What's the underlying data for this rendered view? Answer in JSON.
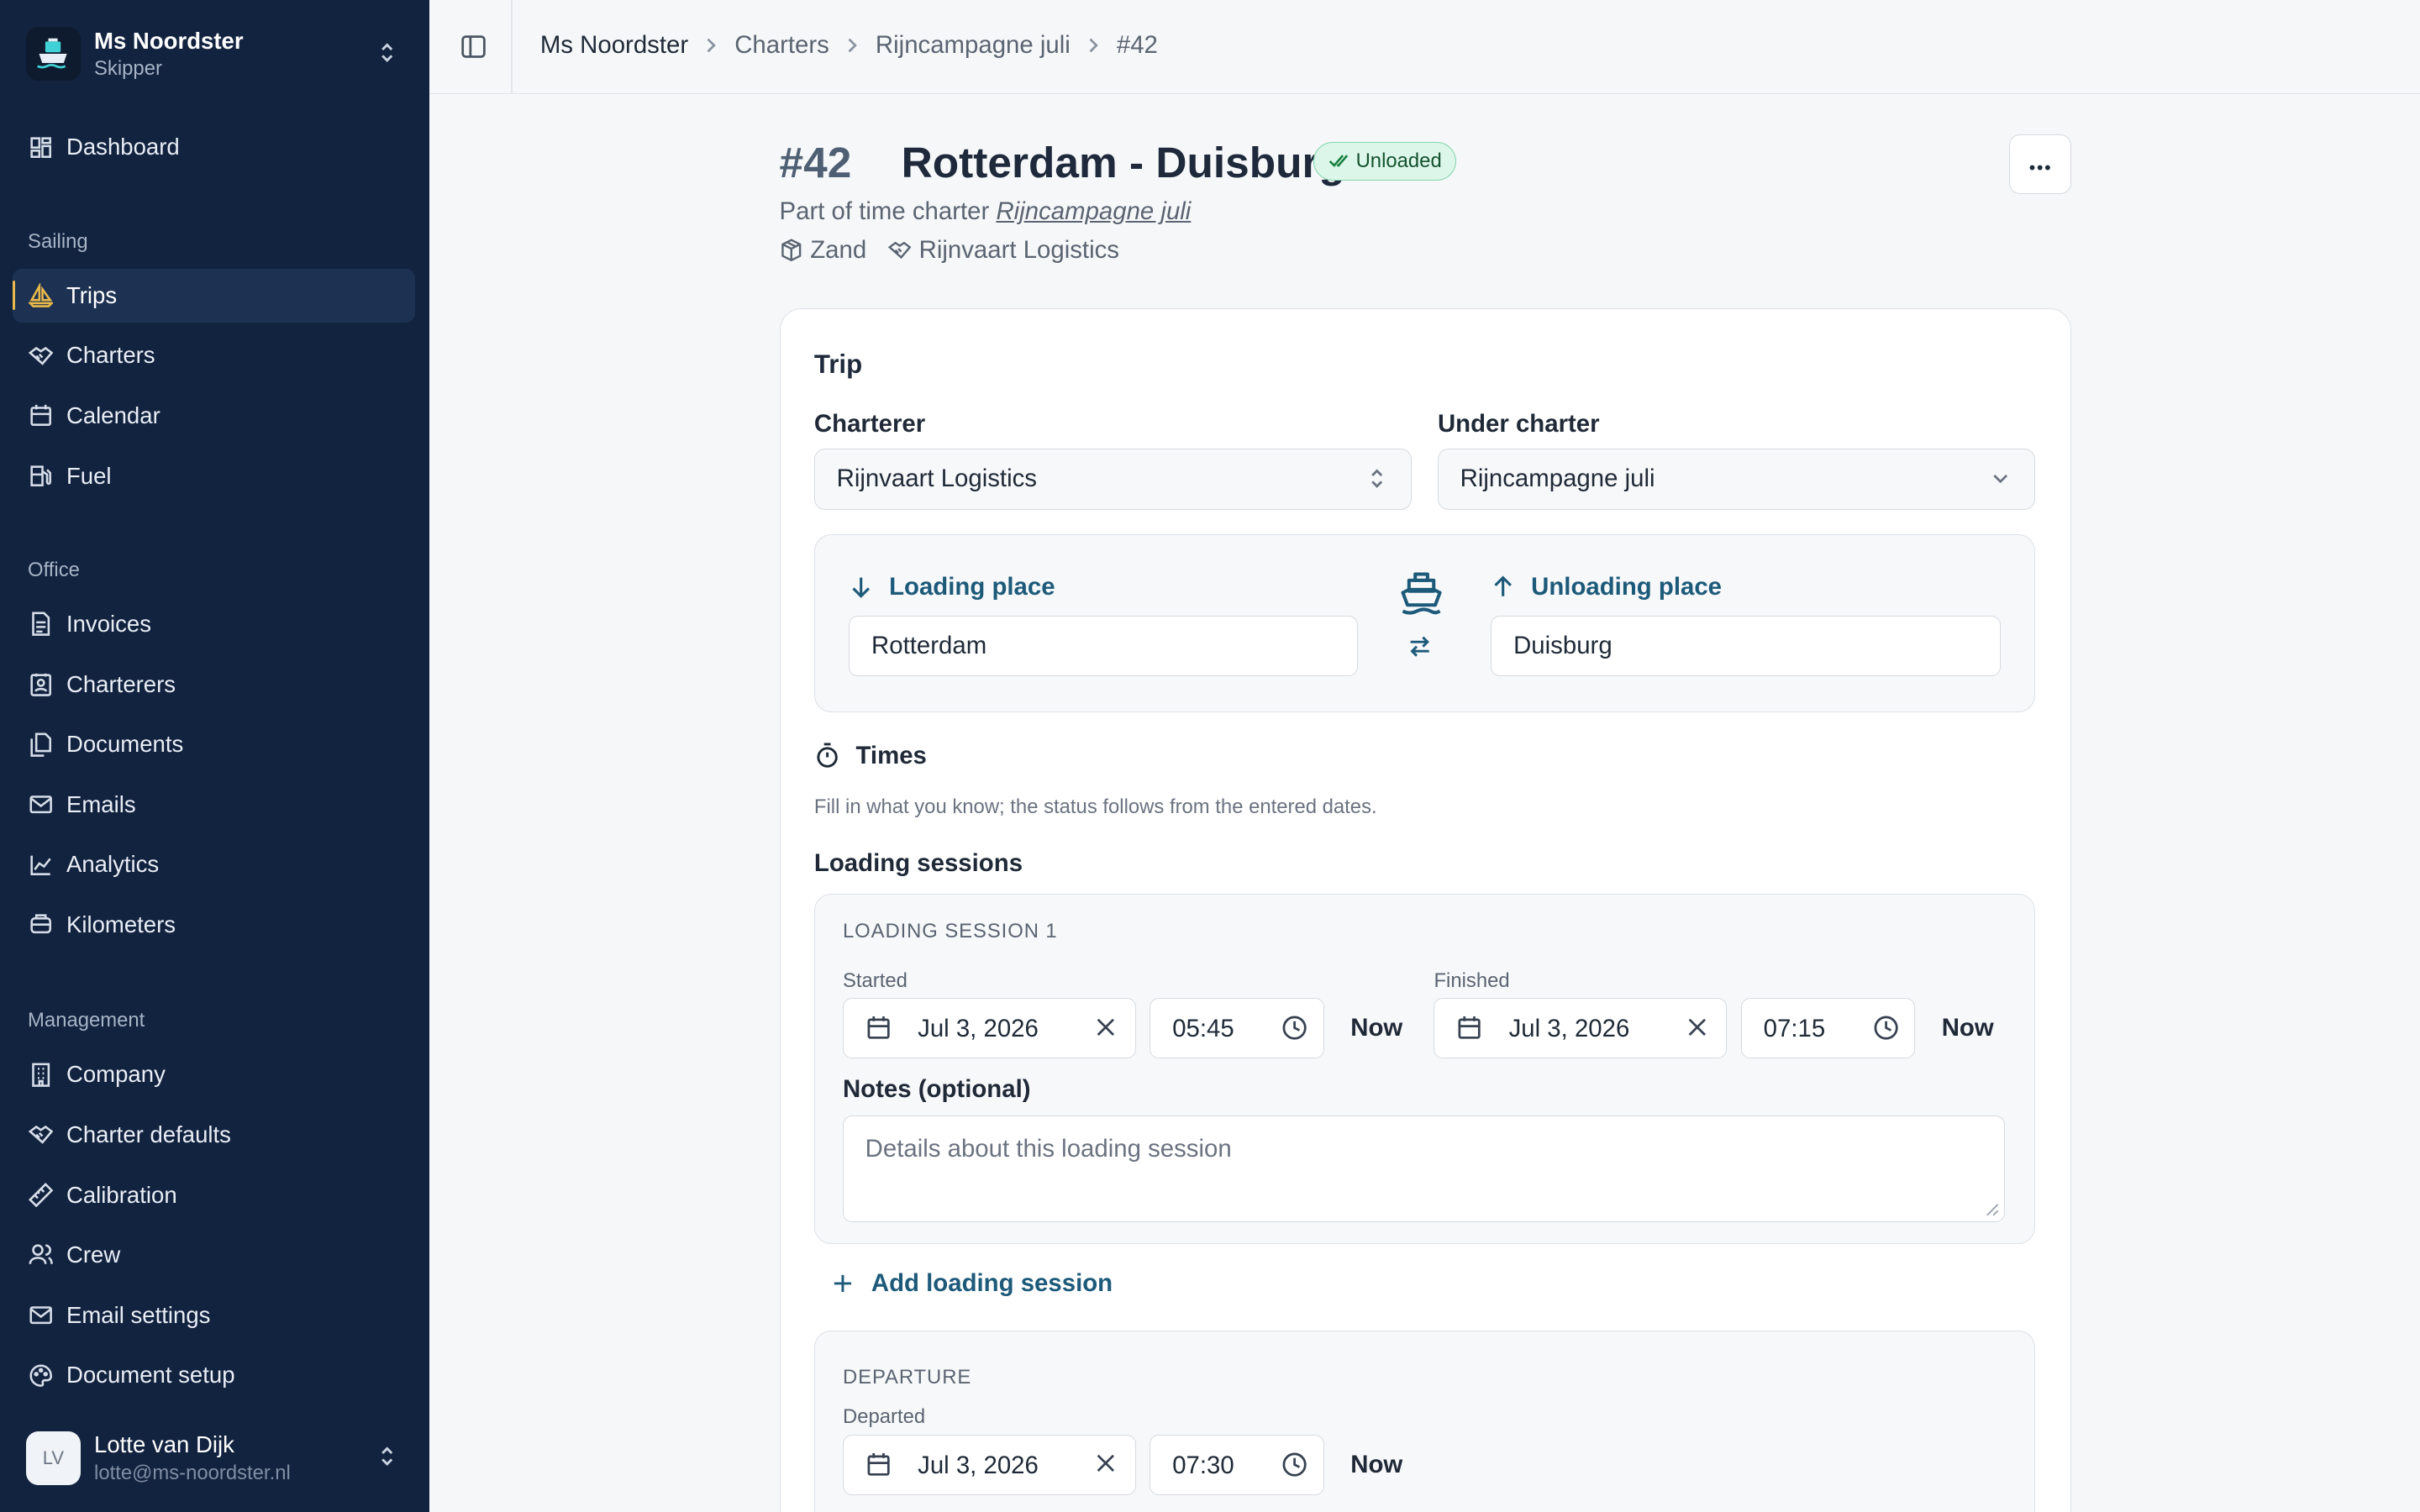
{
  "brand": {
    "name": "Ms Noordster",
    "role": "Skipper"
  },
  "nav": {
    "dashboard": "Dashboard",
    "section_sailing": "Sailing",
    "trips": "Trips",
    "charters": "Charters",
    "calendar": "Calendar",
    "fuel": "Fuel",
    "section_office": "Office",
    "invoices": "Invoices",
    "charterers": "Charterers",
    "documents": "Documents",
    "emails": "Emails",
    "analytics": "Analytics",
    "kilometers": "Kilometers",
    "section_management": "Management",
    "company": "Company",
    "charter_defaults": "Charter defaults",
    "calibration": "Calibration",
    "crew": "Crew",
    "email_settings": "Email settings",
    "document_setup": "Document setup"
  },
  "user": {
    "initials": "LV",
    "name": "Lotte van Dijk",
    "email": "lotte@ms-noordster.nl"
  },
  "breadcrumb": [
    "Ms Noordster",
    "Charters",
    "Rijncampagne juli",
    "#42"
  ],
  "trip": {
    "number": "#42",
    "title": "Rotterdam - Duisburg",
    "status": "Unloaded",
    "part_of_prefix": "Part of time charter",
    "part_of_link": "Rijncampagne juli",
    "cargo": "Zand",
    "charterer_meta": "Rijnvaart Logistics"
  },
  "form": {
    "card_title": "Trip",
    "charterer_label": "Charterer",
    "charterer_value": "Rijnvaart Logistics",
    "under_charter_label": "Under charter",
    "under_charter_value": "Rijncampagne juli",
    "loading_place_label": "Loading place",
    "loading_place_value": "Rotterdam",
    "unloading_place_label": "Unloading place",
    "unloading_place_value": "Duisburg",
    "times_label": "Times",
    "times_hint": "Fill in what you know; the status follows from the entered dates.",
    "loading_sessions_label": "Loading sessions",
    "session1": {
      "title": "LOADING SESSION 1",
      "started_label": "Started",
      "started_date": "Jul 3, 2026",
      "started_time": "05:45",
      "finished_label": "Finished",
      "finished_date": "Jul 3, 2026",
      "finished_time": "07:15",
      "now_label": "Now",
      "notes_label": "Notes (optional)",
      "notes_placeholder": "Details about this loading session"
    },
    "add_session": "Add loading session",
    "departure": {
      "title": "DEPARTURE",
      "departed_label": "Departed",
      "date": "Jul 3, 2026",
      "time": "07:30",
      "now_label": "Now"
    }
  },
  "colors": {
    "sidebar": "#122340",
    "accent": "#1d5a7a",
    "active_marker": "#e9b949",
    "status_bg": "#ddf6ea"
  }
}
